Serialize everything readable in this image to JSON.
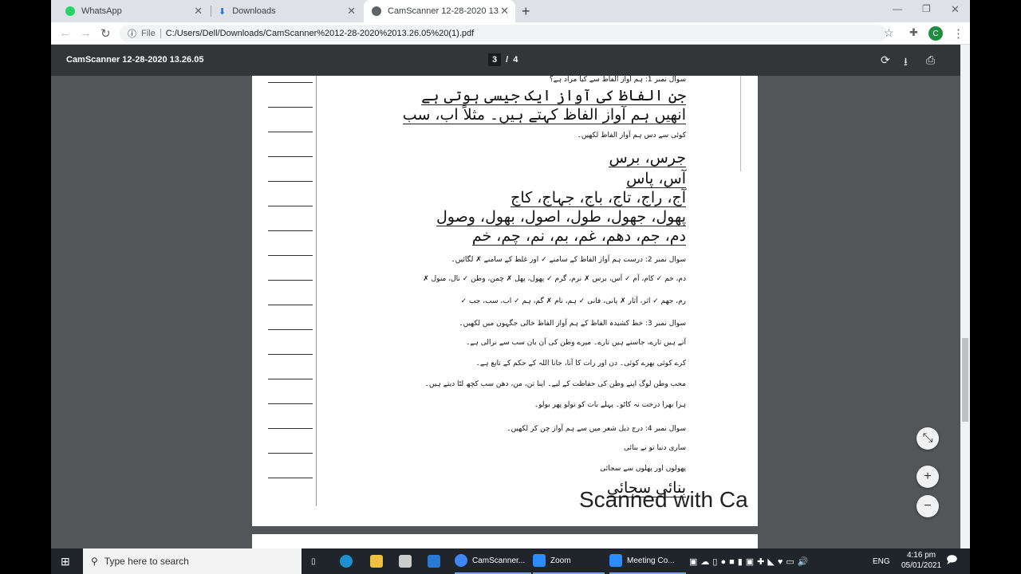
{
  "tabs": [
    {
      "label": "WhatsApp",
      "icon": "whatsapp-icon",
      "color": "#25d366"
    },
    {
      "label": "Downloads",
      "icon": "download-icon",
      "color": "#1a73e8"
    },
    {
      "label": "CamScanner 12-28-2020 13.26.05",
      "icon": "globe-icon",
      "color": "#5f6368",
      "active": true
    }
  ],
  "address": {
    "scheme_label": "File",
    "url": "C:/Users/Dell/Downloads/CamScanner%2012-28-2020%2013.26.05%20(1).pdf",
    "profile_initial": "C"
  },
  "pdf": {
    "title": "CamScanner 12-28-2020 13.26.05",
    "current_page": "3",
    "separator": "/",
    "total_pages": "4"
  },
  "document": {
    "lines": [
      {
        "text": "سوال نمبر 1: ہم آواز الفاظ سے کیا مراد ہے؟",
        "kind": "pr"
      },
      {
        "text": "جن الفاظ کی آواز ایک جیسی ہوتی ہے",
        "kind": "hw"
      },
      {
        "text": "انھیں ہم آواز الفاظ کہتے ہیں۔ مثلاً اب، سب",
        "kind": "hw"
      },
      {
        "text": "کوئی سے دس ہم آواز الفاظ لکھیں۔",
        "kind": "pr"
      },
      {
        "text": "جرس، برس",
        "kind": "hw"
      },
      {
        "text": "آس، پاس",
        "kind": "hw"
      },
      {
        "text": "آج، راج، تاج، باج، جہاج، کاج",
        "kind": "hw"
      },
      {
        "text": "پھول، جھول، طول، اصول، بھول، وصول",
        "kind": "hw"
      },
      {
        "text": "دم، جم، دھم، غم، بم، نم، چم، خم",
        "kind": "hw"
      },
      {
        "text": "سوال نمبر 2: درست ہم آواز الفاظ کے سامنے ✓ اور غلط کے سامنے ✗ لگائیں۔",
        "kind": "pr"
      },
      {
        "text": "دم، خم ✓   کام، آم ✓   آس، برس ✗   نرم، گرم ✓   پھول، پھل ✗   چمن، وطن ✓   نال، منول ✗",
        "kind": "pr"
      },
      {
        "text": "رم، جھم ✓   اثر، آثار ✗   پانی، فانی ✓   ہم، نام ✗   گم، ہم ✓   اب، سب، جب ✓",
        "kind": "pr"
      },
      {
        "text": "سوال نمبر 3: خط کشیدہ الفاظ کے ہم آواز الفاظ خالی جگہوں میں لکھیں۔",
        "kind": "pr"
      },
      {
        "text": "آتے ہیں تارے، جاسنے ہیں تارے۔        میرے وطن کی آن بان سب سے نرالی ہے۔",
        "kind": "pr"
      },
      {
        "text": "کرے کوئی بھرے کوئی۔        دن اور رات کا آنا، جانا اللہ کے حکم کے تابع ہے۔",
        "kind": "pr"
      },
      {
        "text": "محب وطن لوگ اپنے وطن کی حفاظت کے لیے۔        اپنا تن، من، دھن سب کچھ لٹا دیتے ہیں۔",
        "kind": "pr"
      },
      {
        "text": "ہرا بھرا درخت نہ کاٹو۔        پہلے بات کو تولو پھر بولو۔",
        "kind": "pr"
      },
      {
        "text": "سوال نمبر 4: درج ذیل شعر میں سے ہم آواز چن کر لکھیں۔",
        "kind": "pr"
      },
      {
        "text": "ساری دنیا تو نے بنائی",
        "kind": "pr"
      },
      {
        "text": "پھولوں اور پھلوں سے سجائی",
        "kind": "pr"
      },
      {
        "text": "بنائی        سجائی",
        "kind": "hw"
      }
    ],
    "watermark": "Scanned with Ca"
  },
  "taskbar": {
    "search_placeholder": "Type here to search",
    "apps": [
      {
        "label": "CamScanner...",
        "color": "#4285f4"
      },
      {
        "label": "Zoom",
        "color": "#2d8cff"
      },
      {
        "label": "Meeting Co...",
        "color": "#2d8cff"
      }
    ],
    "language": "ENG",
    "time": "4:16 pm",
    "date": "05/01/2021"
  }
}
